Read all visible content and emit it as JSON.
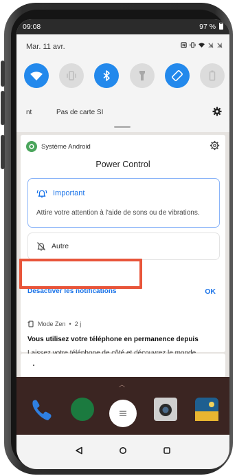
{
  "status_bar": {
    "time": "09:08",
    "battery": "97 %"
  },
  "quick_settings": {
    "date": "Mar. 11 avr.",
    "row_left": "nt",
    "carrier": "Pas de carte SI",
    "tiles": [
      {
        "icon": "wifi-icon",
        "state": "on"
      },
      {
        "icon": "vibrate-icon",
        "state": "off"
      },
      {
        "icon": "bluetooth-icon",
        "state": "on"
      },
      {
        "icon": "flashlight-icon",
        "state": "off"
      },
      {
        "icon": "auto-rotate-icon",
        "state": "on"
      },
      {
        "icon": "battery-saver-icon",
        "state": "off"
      }
    ]
  },
  "notification": {
    "app_name": "Système Android",
    "title": "Power Control",
    "important": {
      "label": "Important",
      "description": "Attire votre attention à l'aide de sons ou de vibrations."
    },
    "other": {
      "label": "Autre"
    },
    "disable_label": "Désactiver les notifications",
    "ok_label": "OK"
  },
  "notification2": {
    "app": "Mode Zen",
    "time": "2 j",
    "title": "Vous utilisez votre téléphone en permanence depuis",
    "body": "Laissez votre téléphone de côté et découvrez le monde"
  },
  "colors": {
    "accent": "#1a73e8",
    "tile_on": "#2389ec",
    "highlight_box": "#e8553a"
  }
}
